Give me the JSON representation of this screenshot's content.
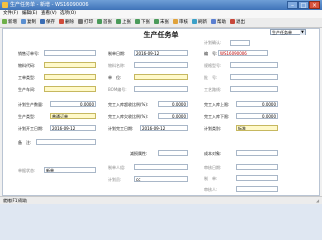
{
  "window": {
    "title": "生产任务单 - 新增 - WS16090006",
    "minimize": "–",
    "maximize": "□",
    "close": "×"
  },
  "menu": [
    "文件(F)",
    "编辑(E)",
    "查看(V)",
    "选项(O)"
  ],
  "toolbar": [
    "新增",
    "复制",
    "保存",
    "删除",
    "打印",
    "首张",
    "上张",
    "下张",
    "末张",
    "审核",
    "刷新",
    "帮助",
    "退出"
  ],
  "form": {
    "title": "生产任务单",
    "type_select": "生产任务单",
    "fields": {
      "sales_order_no": {
        "label": "销售订单号:",
        "value": ""
      },
      "plan_date": {
        "label": "制单日期:",
        "value": "2016-09-12"
      },
      "doc_no": {
        "label": "编　号:",
        "value": "WS16090006"
      },
      "category_label": "计划确认:",
      "material_code": {
        "label": "物料代码:",
        "value": ""
      },
      "material_name": {
        "label": "物料名称:",
        "value": ""
      },
      "spec": {
        "label": "规格型号:",
        "value": ""
      },
      "work_type": {
        "label": "工单类型:",
        "value": ""
      },
      "unit": {
        "label": "单　位:",
        "value": ""
      },
      "batch": {
        "label": "批　号:",
        "value": ""
      },
      "workshop": {
        "label": "生产车间:",
        "value": ""
      },
      "bom": {
        "label": "BOM编号:",
        "value": ""
      },
      "route": {
        "label": "工艺路线:",
        "value": ""
      },
      "plan_qty": {
        "label": "计划生产数量:",
        "value": "0.0000"
      },
      "in_limit_upper": {
        "label": "完工入库超收比例(%):",
        "value": "0.0000"
      },
      "in_limit_upper_qty": {
        "label": "完工入库上限:",
        "value": "0.0000"
      },
      "prod_type": {
        "label": "生产类型:",
        "value": "普通订单"
      },
      "in_limit_lower": {
        "label": "完工入库欠收比例(%):",
        "value": "0.0000"
      },
      "in_limit_lower_qty": {
        "label": "完工入库下限:",
        "value": "0.0000"
      },
      "plan_start": {
        "label": "计划开工日期:",
        "value": "2016-09-12"
      },
      "plan_finish": {
        "label": "计划完工日期:",
        "value": "2016-09-12"
      },
      "plan_category": {
        "label": "计划类别:",
        "value": "标准"
      },
      "remark": {
        "label": "备　注:",
        "value": ""
      },
      "reduce_attr": {
        "label": "减损属性:",
        "value": ""
      },
      "cost_object": {
        "label": "成本对象:",
        "value": ""
      },
      "creator_group": {
        "label": "制单人组:",
        "value": ""
      },
      "approve_date": {
        "label": "审核日期:",
        "value": ""
      },
      "maker": {
        "label": "制　单:",
        "value": ""
      },
      "doc_status_label": "单据状态:",
      "doc_status": "新单",
      "auditor": {
        "label": "审核人:",
        "value": ""
      },
      "creator_label": "计划员:",
      "creator": "cc"
    }
  },
  "status": "就绪(F1)帮助"
}
